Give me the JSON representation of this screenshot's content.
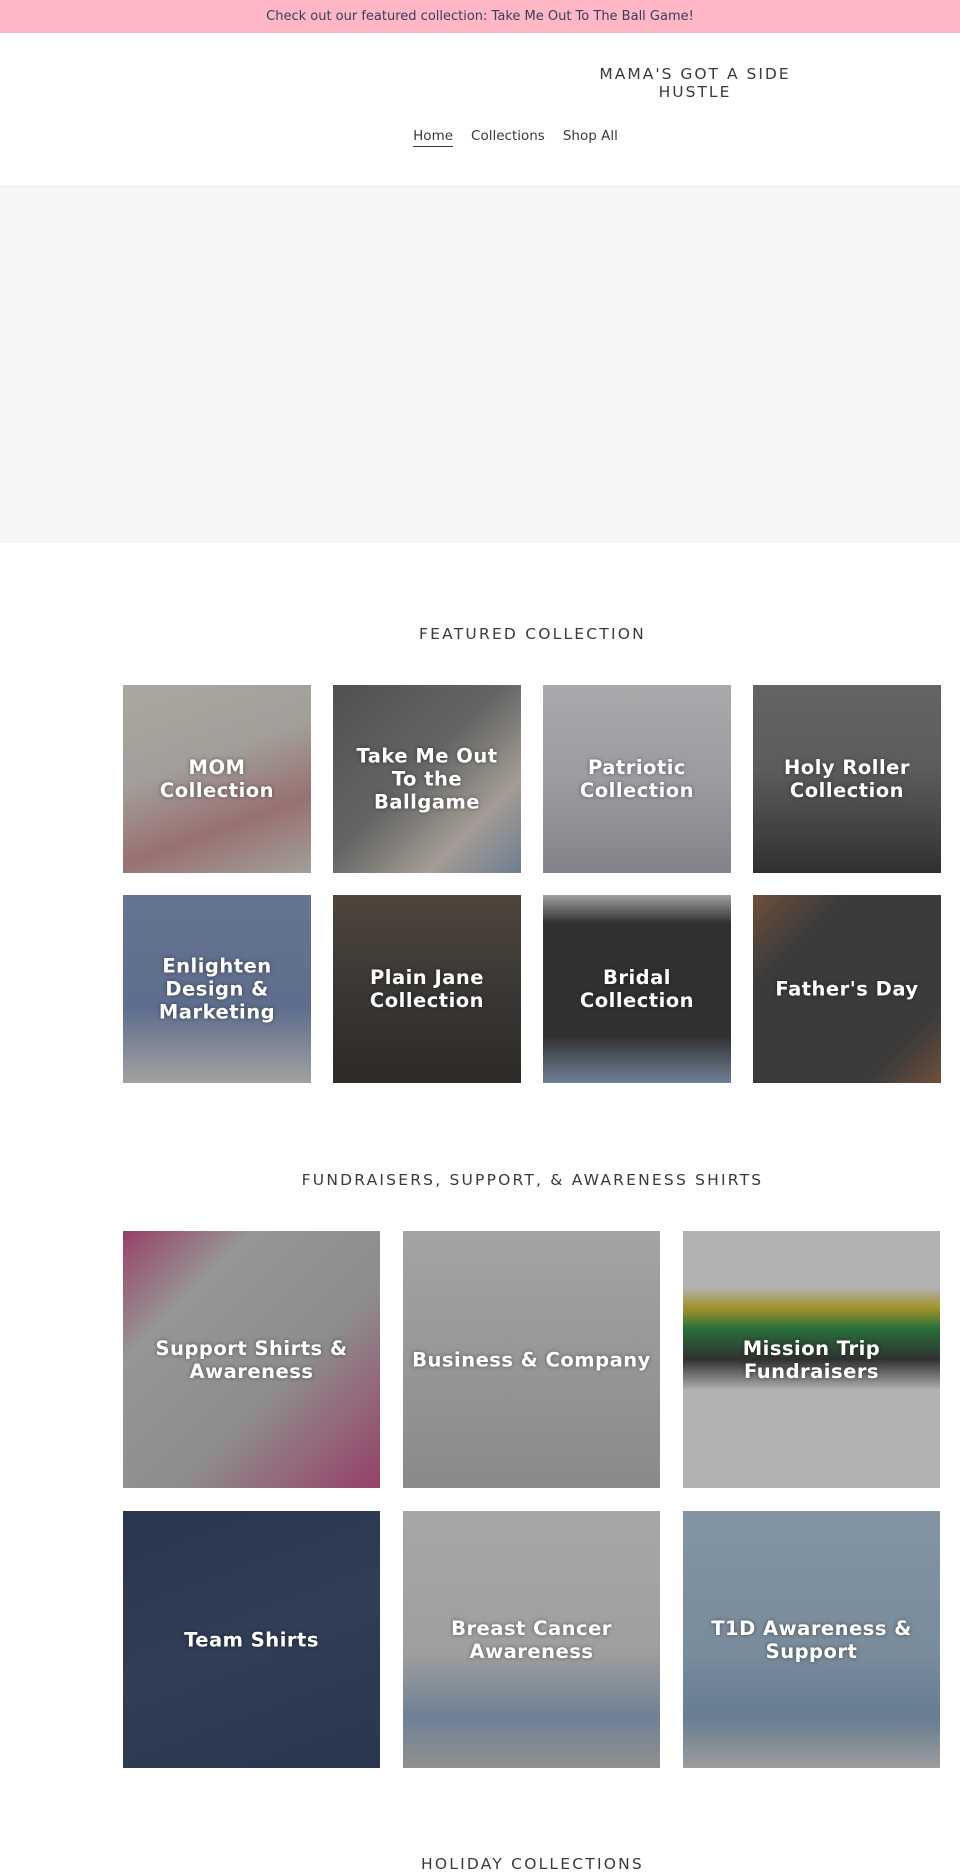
{
  "announcement": "Check out our featured collection: Take Me Out To The Ball Game!",
  "header": {
    "logo": "MAMA'S GOT A SIDE HUSTLE",
    "nav": [
      {
        "label": "Home",
        "active": true
      },
      {
        "label": "Collections",
        "active": false
      },
      {
        "label": "Shop All",
        "active": false
      }
    ]
  },
  "sections": {
    "featured": {
      "title": "FEATURED COLLECTION",
      "tiles": [
        {
          "label": "MOM Collection",
          "colors": [
            "#d9d4cc",
            "#c47a7a"
          ]
        },
        {
          "label": "Take Me Out To the Ballgame",
          "colors": [
            "#6b6b6b",
            "#d9d0c4"
          ]
        },
        {
          "label": "Patriotic Collection",
          "colors": [
            "#cfd0d6",
            "#a8aab2"
          ]
        },
        {
          "label": "Holy Roller Collection",
          "colors": [
            "#6d6d70",
            "#2a2a2a"
          ]
        },
        {
          "label": "Enlighten Design & Marketing",
          "colors": [
            "#6f88b8",
            "#d8d8d8"
          ]
        },
        {
          "label": "Plain Jane Collection",
          "colors": [
            "#3e3a36",
            "#24201d"
          ]
        },
        {
          "label": "Bridal Collection",
          "colors": [
            "#2c2c2c",
            "#d6d6d6"
          ]
        },
        {
          "label": "Father's Day",
          "colors": [
            "#8a5a3a",
            "#3b3b3b"
          ]
        }
      ]
    },
    "fundraisers": {
      "title": "FUNDRAISERS, SUPPORT, & AWARENESS SHIRTS",
      "tiles": [
        {
          "label": "Support Shirts & Awareness",
          "colors": [
            "#b9b9b9",
            "#c9437e"
          ]
        },
        {
          "label": "Business & Company",
          "colors": [
            "#c8c8ca",
            "#b3b3b6"
          ]
        },
        {
          "label": "Mission Trip Fundraisers",
          "colors": [
            "#f2f2f2",
            "#2b2b2b"
          ]
        },
        {
          "label": "Team Shirts",
          "colors": [
            "#1f3458",
            "#2a3f66"
          ]
        },
        {
          "label": "Breast Cancer Awareness",
          "colors": [
            "#d4d4d4",
            "#bdbdbd"
          ]
        },
        {
          "label": "T1D Awareness & Support",
          "colors": [
            "#9bb7d0",
            "#cfcfcf"
          ]
        }
      ]
    },
    "holiday": {
      "title": "HOLIDAY COLLECTIONS"
    }
  }
}
